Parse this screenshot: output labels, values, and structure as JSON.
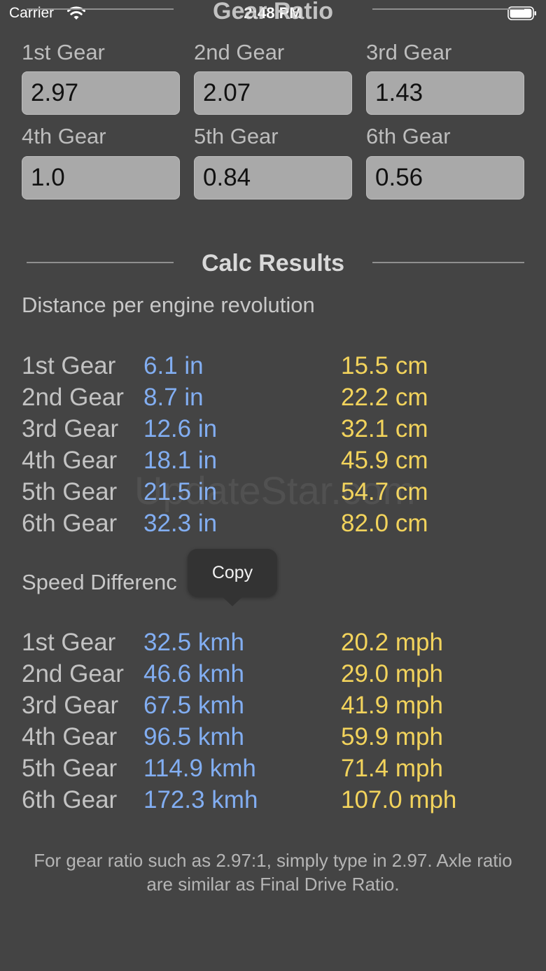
{
  "status_bar": {
    "carrier": "Carrier",
    "time": "2:48 PM"
  },
  "header": {
    "title": "Gear Ratio"
  },
  "gears": [
    {
      "label": "1st Gear",
      "value": "2.97"
    },
    {
      "label": "2nd Gear",
      "value": "2.07"
    },
    {
      "label": "3rd Gear",
      "value": "1.43"
    },
    {
      "label": "4th Gear",
      "value": "1.0"
    },
    {
      "label": "5th Gear",
      "value": "0.84"
    },
    {
      "label": "6th Gear",
      "value": "0.56"
    }
  ],
  "results": {
    "title": "Calc Results",
    "distance": {
      "title": "Distance per engine revolution",
      "rows": [
        {
          "gear": "1st Gear",
          "imperial": "6.1 in",
          "metric": "15.5 cm"
        },
        {
          "gear": "2nd Gear",
          "imperial": "8.7 in",
          "metric": "22.2 cm"
        },
        {
          "gear": "3rd Gear",
          "imperial": "12.6 in",
          "metric": "32.1 cm"
        },
        {
          "gear": "4th Gear",
          "imperial": "18.1 in",
          "metric": "45.9 cm"
        },
        {
          "gear": "5th Gear",
          "imperial": "21.5 in",
          "metric": "54.7 cm"
        },
        {
          "gear": "6th Gear",
          "imperial": "32.3 in",
          "metric": "82.0 cm"
        }
      ]
    },
    "speed": {
      "title": "Speed Differenc",
      "rows": [
        {
          "gear": "1st Gear",
          "metric": "32.5 kmh",
          "imperial": "20.2 mph"
        },
        {
          "gear": "2nd Gear",
          "metric": "46.6 kmh",
          "imperial": "29.0 mph"
        },
        {
          "gear": "3rd Gear",
          "metric": "67.5 kmh",
          "imperial": "41.9 mph"
        },
        {
          "gear": "4th Gear",
          "metric": "96.5 kmh",
          "imperial": "59.9 mph"
        },
        {
          "gear": "5th Gear",
          "metric": "114.9 kmh",
          "imperial": "71.4 mph"
        },
        {
          "gear": "6th Gear",
          "metric": "172.3 kmh",
          "imperial": "107.0 mph"
        }
      ]
    }
  },
  "copy_menu": {
    "label": "Copy"
  },
  "footer": {
    "note": "For gear ratio such as 2.97:1, simply type in 2.97. Axle ratio are similar as Final Drive Ratio."
  },
  "watermark": "UpdateStar.com",
  "colors": {
    "background": "#444444",
    "blue_value": "#82aef2",
    "yellow_value": "#f2d35c"
  }
}
